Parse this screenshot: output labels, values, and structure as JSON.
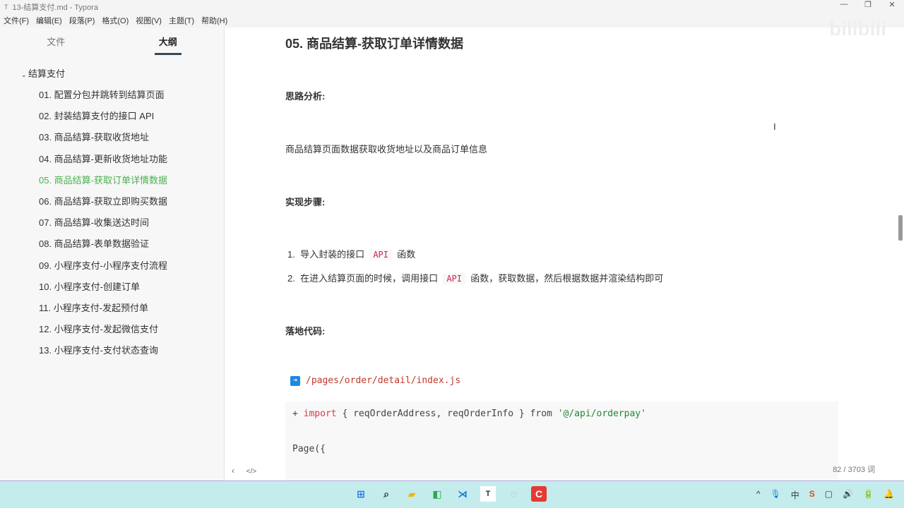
{
  "window": {
    "title": "13-结算支付.md - Typora",
    "min": "—",
    "max": "❐",
    "close": "✕"
  },
  "menu": [
    "文件(F)",
    "编辑(E)",
    "段落(P)",
    "格式(O)",
    "视图(V)",
    "主题(T)",
    "帮助(H)"
  ],
  "sidebar": {
    "tabs": [
      "文件",
      "大纲"
    ],
    "root": "结算支付",
    "items": [
      "01. 配置分包并跳转到结算页面",
      "02. 封装结算支付的接口 API",
      "03. 商品结算-获取收货地址",
      "04. 商品结算-更新收货地址功能",
      "05. 商品结算-获取订单详情数据",
      "06. 商品结算-获取立即购买数据",
      "07. 商品结算-收集送达时间",
      "08. 商品结算-表单数据验证",
      "09. 小程序支付-小程序支付流程",
      "10. 小程序支付-创建订单",
      "11. 小程序支付-发起预付单",
      "12. 小程序支付-发起微信支付",
      "13. 小程序支付-支付状态查询"
    ],
    "bottom_left": "‹",
    "bottom_code": "</>"
  },
  "doc": {
    "heading": "05. 商品结算-获取订单详情数据",
    "analysis_label": "思路分析:",
    "analysis_text": "商品结算页面数据获取收货地址以及商品订单信息",
    "steps_label": "实现步骤:",
    "step1_num": "1.",
    "step1_a": "导入封装的接口",
    "step1_code": "API",
    "step1_b": "函数",
    "step2_num": "2.",
    "step2_a": "在进入结算页面的时候，调用接口",
    "step2_code": "API",
    "step2_b": "函数，获取数据，然后根据数据并渲染结构即可",
    "code_label": "落地代码:",
    "file_path": "/pages/order/detail/index.js",
    "code_plus": "+ ",
    "code_import": "import",
    "code_mid": " { reqOrderAddress, reqOrderInfo } from ",
    "code_str": "'@/api/orderpay'",
    "code_line2": "Page({"
  },
  "status": {
    "word_count": "82 / 3703 词"
  },
  "watermark": "bilibili",
  "tray": [
    "^",
    "🎙",
    "中",
    "S",
    "▢",
    "🔊",
    "🔋",
    "🔔"
  ]
}
